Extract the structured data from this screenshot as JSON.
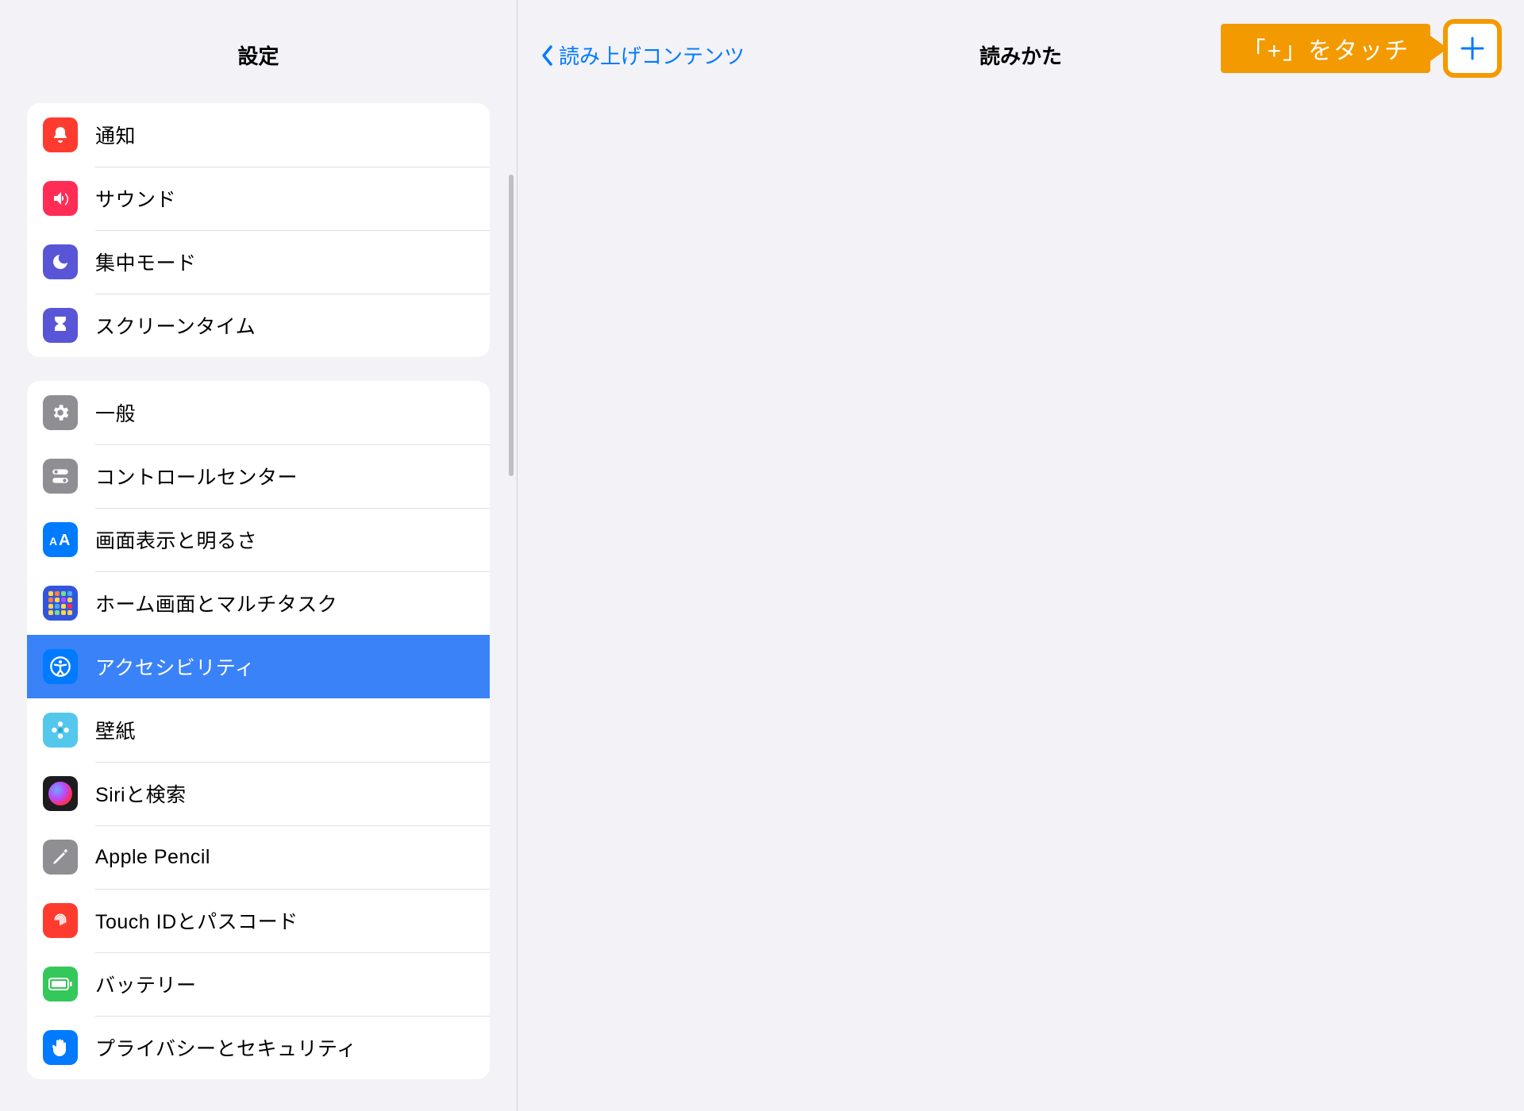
{
  "sidebar": {
    "title": "設定",
    "groups": [
      {
        "rows": [
          {
            "key": "notifications",
            "label": "通知",
            "icon": "notifications",
            "color": "ic-notifications"
          },
          {
            "key": "sounds",
            "label": "サウンド",
            "icon": "sounds",
            "color": "ic-sounds"
          },
          {
            "key": "focus",
            "label": "集中モード",
            "icon": "focus",
            "color": "ic-focus"
          },
          {
            "key": "screentime",
            "label": "スクリーンタイム",
            "icon": "screentime",
            "color": "ic-screentime"
          }
        ]
      },
      {
        "rows": [
          {
            "key": "general",
            "label": "一般",
            "icon": "general",
            "color": "ic-general"
          },
          {
            "key": "control",
            "label": "コントロールセンター",
            "icon": "control",
            "color": "ic-control"
          },
          {
            "key": "display",
            "label": "画面表示と明るさ",
            "icon": "display",
            "color": "ic-display"
          },
          {
            "key": "home",
            "label": "ホーム画面とマルチタスク",
            "icon": "home",
            "color": "ic-home"
          },
          {
            "key": "accessibility",
            "label": "アクセシビリティ",
            "icon": "accessibility",
            "color": "ic-accessibility",
            "selected": true
          },
          {
            "key": "wallpaper",
            "label": "壁紙",
            "icon": "wallpaper",
            "color": "ic-wallpaper"
          },
          {
            "key": "siri",
            "label": "Siriと検索",
            "icon": "siri",
            "color": "ic-siri"
          },
          {
            "key": "pencil",
            "label": "Apple Pencil",
            "icon": "pencil",
            "color": "ic-pencil"
          },
          {
            "key": "touchid",
            "label": "Touch IDとパスコード",
            "icon": "touchid",
            "color": "ic-touchid"
          },
          {
            "key": "battery",
            "label": "バッテリー",
            "icon": "battery",
            "color": "ic-battery"
          },
          {
            "key": "privacy",
            "label": "プライバシーとセキュリティ",
            "icon": "privacy",
            "color": "ic-privacy"
          }
        ]
      }
    ]
  },
  "detail": {
    "back_label": "読み上げコンテンツ",
    "title": "読みかた",
    "tooltip": "「+」をタッチ"
  },
  "colors": {
    "accent": "#007aff",
    "callout": "#f39a00"
  }
}
